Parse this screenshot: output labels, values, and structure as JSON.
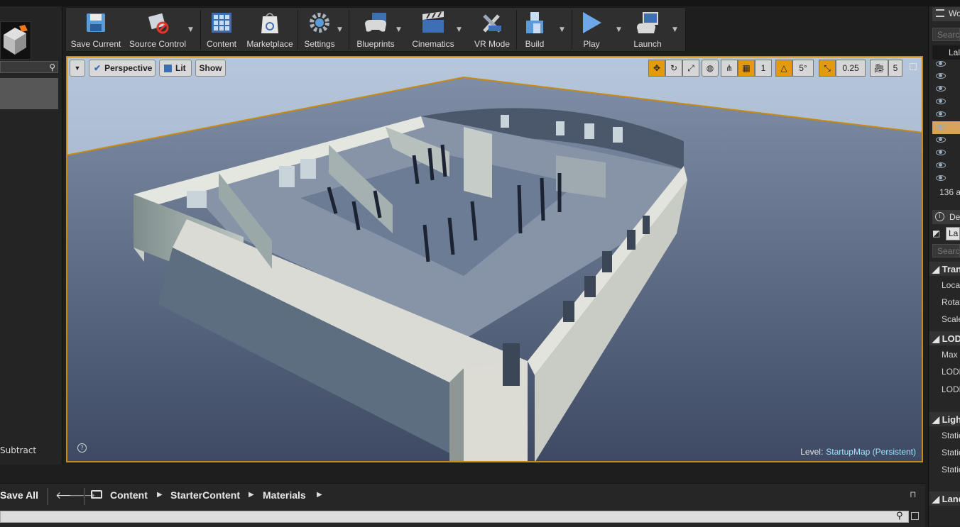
{
  "toolbar": {
    "save_current": "Save Current",
    "source_control": "Source Control",
    "content": "Content",
    "marketplace": "Marketplace",
    "settings": "Settings",
    "blueprints": "Blueprints",
    "cinematics": "Cinematics",
    "vr_mode": "VR Mode",
    "build": "Build",
    "play": "Play",
    "launch": "Launch"
  },
  "left_panel": {
    "subtract_label": "Subtract"
  },
  "viewport": {
    "view_mode": "Perspective",
    "lighting": "Lit",
    "show": "Show",
    "snap_translate": "1",
    "snap_rotate": "5°",
    "snap_scale": "0.25",
    "camera_speed": "5",
    "level_prefix": "Level:",
    "level_name": "StartupMap (Persistent)"
  },
  "content_browser": {
    "save_all": "Save All",
    "breadcrumbs": [
      "Content",
      "StarterContent",
      "Materials"
    ]
  },
  "right_panel": {
    "world_outliner_tab": "Wo",
    "search_placeholder": "Searc",
    "column_label": "Lal",
    "actor_count": "136 a",
    "details_tab": "De",
    "details_actor": "La",
    "details_search": "Search",
    "transform_header": "Trans",
    "location": "Locat",
    "rotation": "Rotat",
    "scale": "Scale",
    "lod_header": "LOD",
    "lod_max": "Max",
    "lod_1": "LODD",
    "lod_2": "LODF",
    "lighting_header": "Light",
    "static_1": "Static",
    "static_2": "Static",
    "static_3": "Static",
    "landscape_header": "Land"
  },
  "colors": {
    "viewport_border": "#c78a13",
    "active_tool": "#e39a0f",
    "level_name": "#9fe3ff"
  }
}
